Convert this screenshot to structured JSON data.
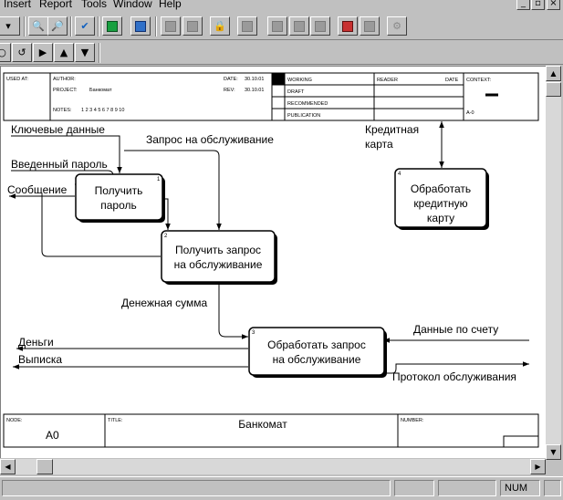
{
  "menu": [
    "Insert",
    "Report",
    "Tools",
    "Window",
    "Help"
  ],
  "window_controls": [
    "_",
    "▫",
    "×"
  ],
  "frame": {
    "used_at_label": "USED AT:",
    "author_label": "AUTHOR:",
    "project_label": "PROJECT:",
    "project_value": "Банкомат",
    "notes_label": "NOTES:",
    "notes_value": "1 2 3 4 5 6 7 8 9 10",
    "date_label": "DATE:",
    "date_value": "30.10.01",
    "rev_label": "REV:",
    "rev_value": "30.10.01",
    "status_working": "WORKING",
    "status_draft": "DRAFT",
    "status_recommended": "RECOMMENDED",
    "status_publication": "PUBLICATION",
    "reader_label": "READER",
    "date_col_label": "DATE",
    "context_label": "CONTEXT:",
    "context_value": "A-0",
    "node_label": "NODE:",
    "node_value": "A0",
    "title_label": "TITLE:",
    "title_value": "Банкомат",
    "number_label": "NUMBER:"
  },
  "boxes": {
    "b1": {
      "line1": "Получить",
      "line2": "пароль",
      "num": "1"
    },
    "b2": {
      "line1": "Получить запрос",
      "line2": "на обслуживание",
      "num": "2"
    },
    "b3": {
      "line1": "Обработать запрос",
      "line2": "на обслуживание",
      "num": "3"
    },
    "b4": {
      "line1": "Обработать",
      "line2": "кредитную",
      "line3": "карту",
      "num": "4"
    }
  },
  "arrows": {
    "key_data": "Ключевые данные",
    "entered_password": "Введенный пароль",
    "message": "Сообщение",
    "service_request": "Запрос на обслуживание",
    "credit_card_1": "Кредитная",
    "credit_card_2": "карта",
    "money_amount": "Денежная сумма",
    "money": "Деньги",
    "statement": "Выписка",
    "account_data": "Данные по счету",
    "service_log": "Протокол обслуживания"
  },
  "status": {
    "num": "NUM"
  }
}
